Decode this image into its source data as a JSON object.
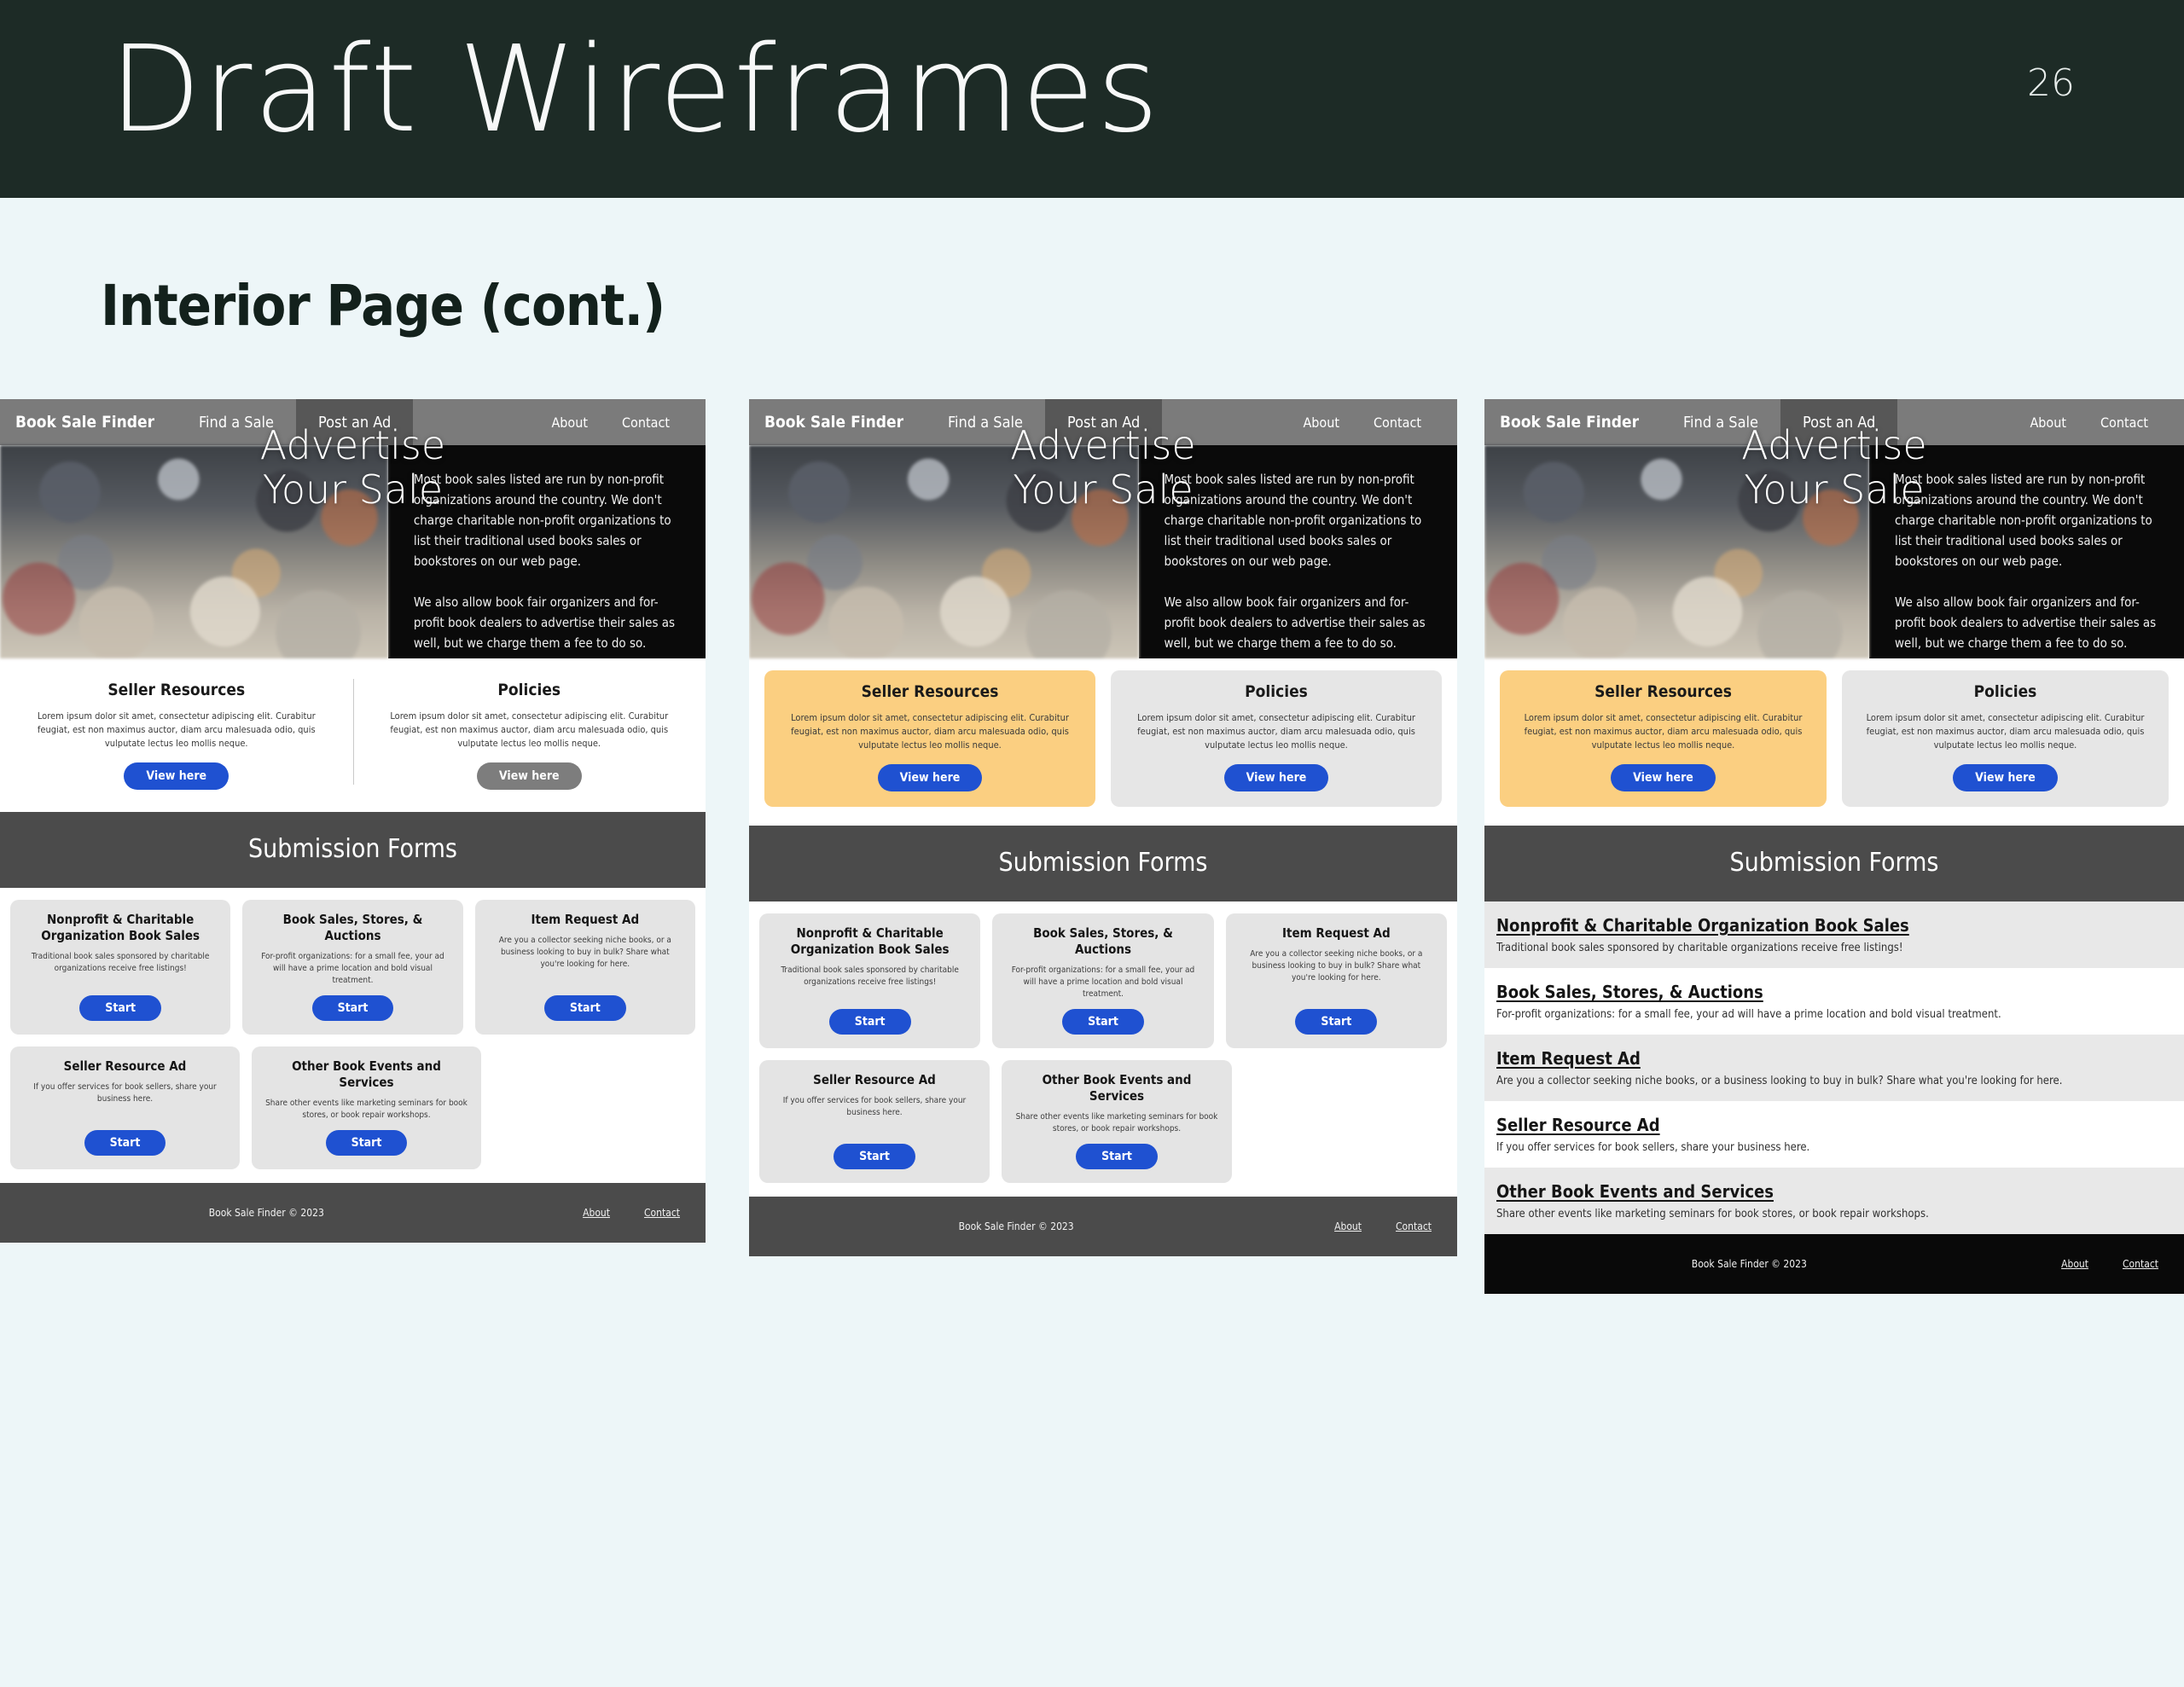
{
  "slide": {
    "title": "Draft Wireframes",
    "page_number": "26",
    "header_bg": "#1d2b26",
    "background": "#edf6f8",
    "section_heading": "Interior Page (cont.)"
  },
  "wireframe": {
    "nav": {
      "brand": "Book Sale Finder",
      "find_a_sale": "Find a Sale",
      "post_an_ad": "Post an Ad",
      "about": "About",
      "contact": "Contact"
    },
    "hero": {
      "title_line1": "Advertise",
      "title_line2": "Your Sale",
      "paragraph1": "Most book sales listed are run by non-profit organizations around the country. We don't charge charitable non-profit organizations to list their traditional used books sales or bookstores on our web page.",
      "paragraph2": "We also allow book fair organizers and for-profit book dealers to advertise their sales as well, but we charge them a fee to do so."
    },
    "resources": {
      "seller_title": "Seller Resources",
      "policies_title": "Policies",
      "lorem": "Lorem ipsum dolor sit amet, consectetur adipiscing elit. Curabitur feugiat, est non maximus auctor, diam arcu malesuada odio, quis vulputate lectus leo mollis neque.",
      "view_here": "View here",
      "amber": "#fbcf81",
      "grey": "#e6e6e6",
      "blue": "#1f51d1"
    },
    "submission_banner": "Submission Forms",
    "forms": [
      {
        "title": "Nonprofit & Charitable Organization Book Sales",
        "body": "Traditional book sales sponsored by charitable organizations receive free listings!",
        "cta": "Start"
      },
      {
        "title": "Book Sales, Stores, & Auctions",
        "body": "For-profit organizations: for a small fee, your ad will have a prime location and bold visual treatment.",
        "cta": "Start"
      },
      {
        "title": "Item Request Ad",
        "body": "Are you a collector seeking niche books, or a business looking to buy in bulk? Share what you're looking for here.",
        "cta": "Start"
      },
      {
        "title": "Seller Resource Ad",
        "body": "If you offer services for book sellers, share your business here.",
        "cta": "Start"
      },
      {
        "title": "Other Book Events and Services",
        "body": "Share other events like marketing seminars for book stores, or book repair workshops.",
        "cta": "Start"
      }
    ],
    "footer": {
      "copyright": "Book Sale Finder © 2023",
      "about": "About",
      "contact": "Contact"
    }
  }
}
